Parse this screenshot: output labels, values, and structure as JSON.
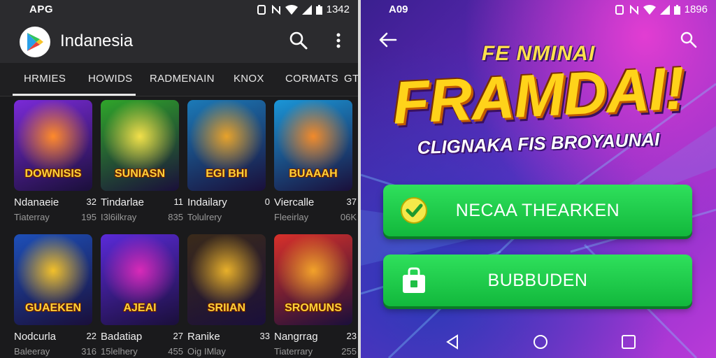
{
  "left": {
    "status": {
      "carrier": "APG",
      "time": "1342"
    },
    "appbar": {
      "title": "Indanesia"
    },
    "tabs": [
      "HRMIES",
      "HOWIDS",
      "RADMENAIN",
      "KNOX",
      "CORMATS",
      "GTI"
    ],
    "grid": [
      {
        "title": "Ndanaeie",
        "rank": "32",
        "sub": "Tiaterray",
        "size": "195",
        "art_text": "DOWNISIS",
        "colors": [
          "#7a2ad8",
          "#ff8a2a"
        ]
      },
      {
        "title": "Tindarlae",
        "rank": "11",
        "sub": "I3l6ilkray",
        "size": "835",
        "art_text": "SUNIASN",
        "colors": [
          "#2fa52a",
          "#f2e04a"
        ]
      },
      {
        "title": "Indailary",
        "rank": "0",
        "sub": "Tolulrery",
        "size": "",
        "art_text": "EGI BHI",
        "colors": [
          "#1b7ab8",
          "#e8a22a"
        ]
      },
      {
        "title": "Viercalle",
        "rank": "37",
        "sub": "Fleeirlay",
        "size": "06K",
        "art_text": "BUAAAH",
        "colors": [
          "#1a96d8",
          "#f28a2a"
        ]
      },
      {
        "title": "Nodcurla",
        "rank": "22",
        "sub": "Baleeray",
        "size": "316",
        "art_text": "GUAEKEN",
        "colors": [
          "#1d4fb8",
          "#f2c02a"
        ]
      },
      {
        "title": "Badatiap",
        "rank": "27",
        "sub": "15lelhery",
        "size": "455",
        "art_text": "AJEAI",
        "colors": [
          "#5a2ad8",
          "#d82ab8"
        ]
      },
      {
        "title": "Ranike",
        "rank": "33",
        "sub": "Oig IMlay",
        "size": "",
        "art_text": "SRIIAN",
        "colors": [
          "#3a2a1a",
          "#e8b02a"
        ]
      },
      {
        "title": "Nangrrag",
        "rank": "23",
        "sub": "Tiaterrary",
        "size": "255",
        "art_text": "SROMUNS",
        "colors": [
          "#d8302a",
          "#f2a22a"
        ]
      }
    ]
  },
  "right": {
    "status": {
      "carrier": "A09",
      "time": "1896"
    },
    "promo": {
      "kicker": "FE NMINAI",
      "headline": "FRAMDAI!",
      "subline": "CLIGNAKA FIS BROYAUNAI"
    },
    "buttons": [
      {
        "label": "NECAA THEARKEN",
        "icon": "check-circle-icon"
      },
      {
        "label": "BUBBUDEN",
        "icon": "shopping-bag-icon"
      }
    ]
  },
  "colors": {
    "accent_green": "#1fcc4a",
    "headline_yellow": "#ffd31a",
    "panel_dark": "#1a1a1c"
  }
}
